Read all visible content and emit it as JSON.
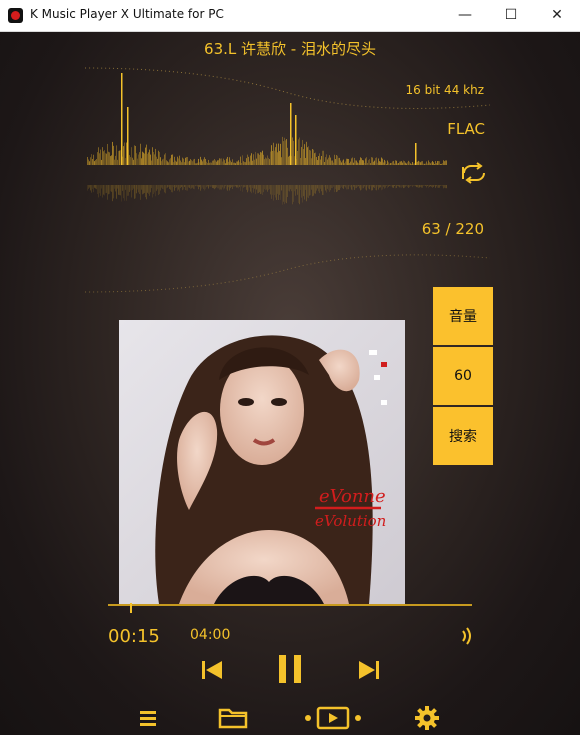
{
  "window": {
    "title": "K Music Player X Ultimate for PC",
    "minimize_glyph": "—",
    "maximize_glyph": "☐",
    "close_glyph": "✕"
  },
  "track": {
    "title": "63.L  许慧欣 - 泪水的尽头",
    "bitrate": "16 bit 44 khz",
    "format": "FLAC",
    "counter": "63 / 220",
    "current_time": "00:15",
    "total_time": "04:00",
    "progress_fraction": 0.06
  },
  "side_buttons": {
    "volume_label": "音量",
    "volume_value": "60",
    "search_label": "搜索"
  },
  "cover": {
    "logo_top": "eVonne",
    "logo_bottom": "eVolution"
  },
  "colors": {
    "accent": "#f4c22b",
    "button_bg": "#fbc12d"
  },
  "icons": {
    "repeat": "repeat-icon",
    "volume": "volume-icon",
    "prev": "skip-previous-icon",
    "play_pause": "pause-icon",
    "next": "skip-next-icon",
    "menu": "menu-icon",
    "folder": "folder-icon",
    "video": "video-icon",
    "settings": "gear-icon"
  }
}
